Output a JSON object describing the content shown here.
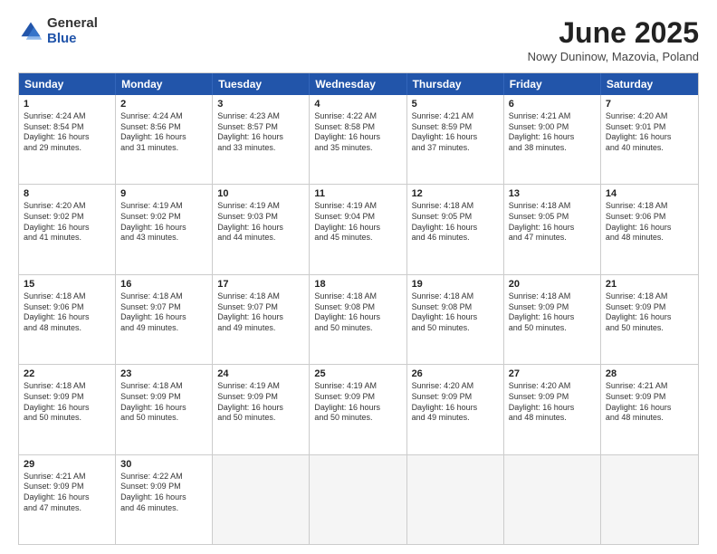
{
  "header": {
    "logo_general": "General",
    "logo_blue": "Blue",
    "title": "June 2025",
    "location": "Nowy Duninow, Mazovia, Poland"
  },
  "weekdays": [
    "Sunday",
    "Monday",
    "Tuesday",
    "Wednesday",
    "Thursday",
    "Friday",
    "Saturday"
  ],
  "rows": [
    [
      {
        "day": "1",
        "text": "Sunrise: 4:24 AM\nSunset: 8:54 PM\nDaylight: 16 hours\nand 29 minutes."
      },
      {
        "day": "2",
        "text": "Sunrise: 4:24 AM\nSunset: 8:56 PM\nDaylight: 16 hours\nand 31 minutes."
      },
      {
        "day": "3",
        "text": "Sunrise: 4:23 AM\nSunset: 8:57 PM\nDaylight: 16 hours\nand 33 minutes."
      },
      {
        "day": "4",
        "text": "Sunrise: 4:22 AM\nSunset: 8:58 PM\nDaylight: 16 hours\nand 35 minutes."
      },
      {
        "day": "5",
        "text": "Sunrise: 4:21 AM\nSunset: 8:59 PM\nDaylight: 16 hours\nand 37 minutes."
      },
      {
        "day": "6",
        "text": "Sunrise: 4:21 AM\nSunset: 9:00 PM\nDaylight: 16 hours\nand 38 minutes."
      },
      {
        "day": "7",
        "text": "Sunrise: 4:20 AM\nSunset: 9:01 PM\nDaylight: 16 hours\nand 40 minutes."
      }
    ],
    [
      {
        "day": "8",
        "text": "Sunrise: 4:20 AM\nSunset: 9:02 PM\nDaylight: 16 hours\nand 41 minutes."
      },
      {
        "day": "9",
        "text": "Sunrise: 4:19 AM\nSunset: 9:02 PM\nDaylight: 16 hours\nand 43 minutes."
      },
      {
        "day": "10",
        "text": "Sunrise: 4:19 AM\nSunset: 9:03 PM\nDaylight: 16 hours\nand 44 minutes."
      },
      {
        "day": "11",
        "text": "Sunrise: 4:19 AM\nSunset: 9:04 PM\nDaylight: 16 hours\nand 45 minutes."
      },
      {
        "day": "12",
        "text": "Sunrise: 4:18 AM\nSunset: 9:05 PM\nDaylight: 16 hours\nand 46 minutes."
      },
      {
        "day": "13",
        "text": "Sunrise: 4:18 AM\nSunset: 9:05 PM\nDaylight: 16 hours\nand 47 minutes."
      },
      {
        "day": "14",
        "text": "Sunrise: 4:18 AM\nSunset: 9:06 PM\nDaylight: 16 hours\nand 48 minutes."
      }
    ],
    [
      {
        "day": "15",
        "text": "Sunrise: 4:18 AM\nSunset: 9:06 PM\nDaylight: 16 hours\nand 48 minutes."
      },
      {
        "day": "16",
        "text": "Sunrise: 4:18 AM\nSunset: 9:07 PM\nDaylight: 16 hours\nand 49 minutes."
      },
      {
        "day": "17",
        "text": "Sunrise: 4:18 AM\nSunset: 9:07 PM\nDaylight: 16 hours\nand 49 minutes."
      },
      {
        "day": "18",
        "text": "Sunrise: 4:18 AM\nSunset: 9:08 PM\nDaylight: 16 hours\nand 50 minutes."
      },
      {
        "day": "19",
        "text": "Sunrise: 4:18 AM\nSunset: 9:08 PM\nDaylight: 16 hours\nand 50 minutes."
      },
      {
        "day": "20",
        "text": "Sunrise: 4:18 AM\nSunset: 9:09 PM\nDaylight: 16 hours\nand 50 minutes."
      },
      {
        "day": "21",
        "text": "Sunrise: 4:18 AM\nSunset: 9:09 PM\nDaylight: 16 hours\nand 50 minutes."
      }
    ],
    [
      {
        "day": "22",
        "text": "Sunrise: 4:18 AM\nSunset: 9:09 PM\nDaylight: 16 hours\nand 50 minutes."
      },
      {
        "day": "23",
        "text": "Sunrise: 4:18 AM\nSunset: 9:09 PM\nDaylight: 16 hours\nand 50 minutes."
      },
      {
        "day": "24",
        "text": "Sunrise: 4:19 AM\nSunset: 9:09 PM\nDaylight: 16 hours\nand 50 minutes."
      },
      {
        "day": "25",
        "text": "Sunrise: 4:19 AM\nSunset: 9:09 PM\nDaylight: 16 hours\nand 50 minutes."
      },
      {
        "day": "26",
        "text": "Sunrise: 4:20 AM\nSunset: 9:09 PM\nDaylight: 16 hours\nand 49 minutes."
      },
      {
        "day": "27",
        "text": "Sunrise: 4:20 AM\nSunset: 9:09 PM\nDaylight: 16 hours\nand 48 minutes."
      },
      {
        "day": "28",
        "text": "Sunrise: 4:21 AM\nSunset: 9:09 PM\nDaylight: 16 hours\nand 48 minutes."
      }
    ],
    [
      {
        "day": "29",
        "text": "Sunrise: 4:21 AM\nSunset: 9:09 PM\nDaylight: 16 hours\nand 47 minutes."
      },
      {
        "day": "30",
        "text": "Sunrise: 4:22 AM\nSunset: 9:09 PM\nDaylight: 16 hours\nand 46 minutes."
      },
      {
        "day": "",
        "text": ""
      },
      {
        "day": "",
        "text": ""
      },
      {
        "day": "",
        "text": ""
      },
      {
        "day": "",
        "text": ""
      },
      {
        "day": "",
        "text": ""
      }
    ]
  ]
}
